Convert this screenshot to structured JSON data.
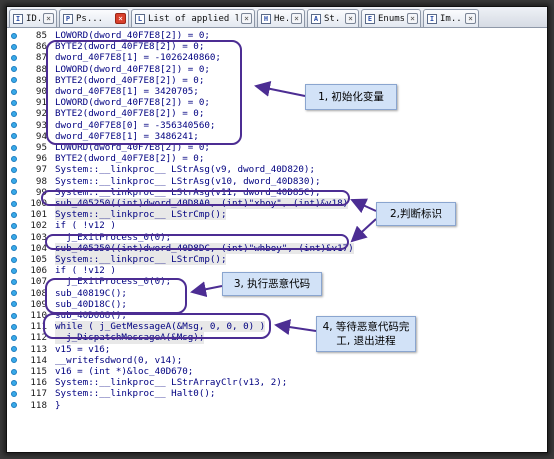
{
  "tabs": [
    {
      "label": "ID...",
      "icon": "ida-view-icon",
      "active": false
    },
    {
      "label": "Ps...",
      "icon": "pseudocode-icon",
      "active": true
    },
    {
      "label": "List of applied libr...",
      "icon": "list-icon",
      "active": false
    },
    {
      "label": "He...",
      "icon": "hex-view-icon",
      "active": false
    },
    {
      "label": "St...",
      "icon": "structures-icon",
      "active": false
    },
    {
      "label": "Enums",
      "icon": "enums-icon",
      "active": false
    },
    {
      "label": "Im...",
      "icon": "imports-icon",
      "active": false
    }
  ],
  "code_lines": [
    {
      "no": "85",
      "text": "LOWORD(dword_40F7E8[2]) = 0;"
    },
    {
      "no": "86",
      "text": "BYTE2(dword_40F7E8[2]) = 0;"
    },
    {
      "no": "87",
      "text": "dword_40F7E8[1] = -1026240860;"
    },
    {
      "no": "88",
      "text": "LOWORD(dword_40F7E8[2]) = 0;"
    },
    {
      "no": "89",
      "text": "BYTE2(dword_40F7E8[2]) = 0;"
    },
    {
      "no": "90",
      "text": "dword_40F7E8[1] = 3420705;"
    },
    {
      "no": "91",
      "text": "LOWORD(dword_40F7E8[2]) = 0;"
    },
    {
      "no": "92",
      "text": "BYTE2(dword_40F7E8[2]) = 0;"
    },
    {
      "no": "93",
      "text": "dword_40F7E8[0] = -356340560;"
    },
    {
      "no": "94",
      "text": "dword_40F7E8[1] = 3486241;"
    },
    {
      "no": "95",
      "text": "LOWORD(dword_40F7E8[2]) = 0;"
    },
    {
      "no": "96",
      "text": "BYTE2(dword_40F7E8[2]) = 0;"
    },
    {
      "no": "97",
      "text": "System::__linkproc__ LStrAsg(v9, dword_40D820);"
    },
    {
      "no": "98",
      "text": "System::__linkproc__ LStrAsg(v10, dword_40D830);"
    },
    {
      "no": "99",
      "text": "System::__linkproc__ LStrAsg(v11, dword_40D85C);"
    },
    {
      "no": "100",
      "text": "sub_405250((int)dword_40D8A0, (int)\"xboy\", (int)&v18)"
    },
    {
      "no": "101",
      "text": "System::__linkproc__ LStrCmp();"
    },
    {
      "no": "102",
      "text": "if ( !v12 )"
    },
    {
      "no": "103",
      "text": "  j_ExitProcess_0(0);"
    },
    {
      "no": "104",
      "text": "sub_405250((int)dword_40D8DC, (int)\"whboy\", (int)&v17)"
    },
    {
      "no": "105",
      "text": "System::__linkproc__ LStrCmp();"
    },
    {
      "no": "106",
      "text": "if ( !v12 )"
    },
    {
      "no": "107",
      "text": "  j_ExitProcess_0(0);"
    },
    {
      "no": "108",
      "text": "sub_40819C();"
    },
    {
      "no": "109",
      "text": "sub_40D18C();"
    },
    {
      "no": "110",
      "text": "sub_40D088();"
    },
    {
      "no": "111",
      "text": "while ( j_GetMessageA(&Msg, 0, 0, 0) )"
    },
    {
      "no": "112",
      "text": "  j_DispatchMessageA(&Msg);"
    },
    {
      "no": "113",
      "text": "v15 = v16;"
    },
    {
      "no": "114",
      "text": "__writefsdword(0, v14);"
    },
    {
      "no": "115",
      "text": "v16 = (int *)&loc_40D670;"
    },
    {
      "no": "116",
      "text": "System::__linkproc__ LStrArrayClr(v13, 2);"
    },
    {
      "no": "117",
      "text": "System::__linkproc__ Halt0();"
    },
    {
      "no": "118",
      "text": "}"
    }
  ],
  "callouts": [
    {
      "text": "1, 初始化变量"
    },
    {
      "text": "2,判断标识"
    },
    {
      "text": "3, 执行恶意代码"
    },
    {
      "text": "4, 等待恶意代码完工, 退出进程"
    }
  ],
  "colors": {
    "code_text": "#000080",
    "breakpoint_dot": "#38a9e8",
    "oval_border": "#4c2d93",
    "callout_bg": "#d2e2f7",
    "active_tab_close": "#d8402c"
  }
}
